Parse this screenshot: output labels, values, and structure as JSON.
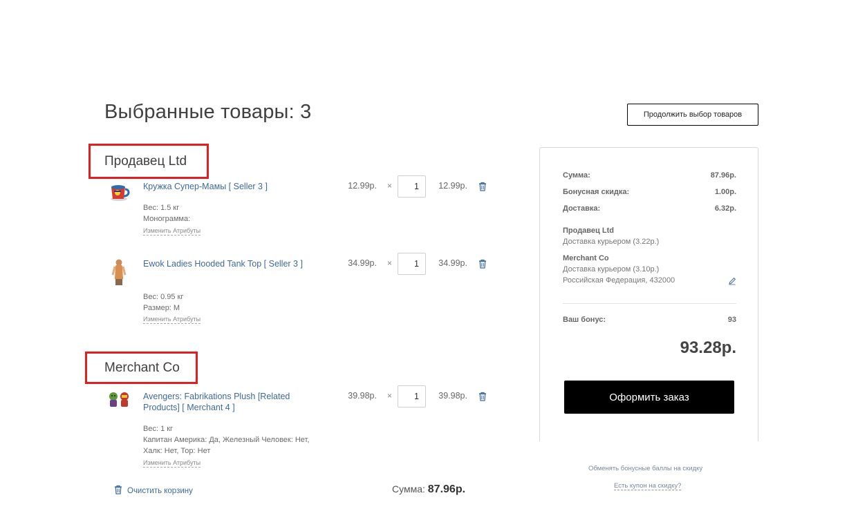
{
  "page": {
    "title": "Выбранные товары: 3",
    "continue_label": "Продолжить выбор товаров"
  },
  "sellers": [
    {
      "name": "Продавец Ltd",
      "items": [
        {
          "name": "Кружка Супер-Мамы [ Seller 3 ]",
          "attrs": [
            "Вес: 1.5 кг",
            "Монограмма:"
          ],
          "change_attrs": "Изменить Атрибуты",
          "price": "12.99р.",
          "times": "×",
          "qty": "1",
          "total": "12.99р.",
          "icon": "trash-icon"
        },
        {
          "name": "Ewok Ladies Hooded Tank Top [ Seller 3 ]",
          "attrs": [
            "Вес: 0.95 кг",
            "Размер: M"
          ],
          "change_attrs": "Изменить Атрибуты",
          "price": "34.99р.",
          "times": "×",
          "qty": "1",
          "total": "34.99р.",
          "icon": "trash-icon"
        }
      ]
    },
    {
      "name": "Merchant Co",
      "items": [
        {
          "name": "Avengers: Fabrikations Plush [Related Products] [ Merchant 4 ]",
          "attrs": [
            "Вес: 1 кг",
            "Капитан Америка: Да, Железный Человек: Нет, Халк: Нет, Тор: Нет"
          ],
          "change_attrs": "Изменить Атрибуты",
          "price": "39.98р.",
          "times": "×",
          "qty": "1",
          "total": "39.98р.",
          "icon": "trash-icon"
        }
      ]
    }
  ],
  "cart": {
    "clear_label": "Очистить корзину",
    "total_label": "Сумма:",
    "total_value": "87.96р."
  },
  "summary": {
    "rows": [
      {
        "label": "Сумма:",
        "value": "87.96р."
      },
      {
        "label": "Бонусная скидка:",
        "value": "1.00р."
      },
      {
        "label": "Доставка:",
        "value": "6.32р."
      }
    ],
    "shipping": [
      {
        "seller": "Продавец Ltd",
        "lines": [
          "Доставка курьером (3.22р.)"
        ]
      },
      {
        "seller": "Merchant Co",
        "lines": [
          "Доставка курьером (3.10р.)",
          "Российская Федерация, 432000"
        ]
      }
    ],
    "bonus_label": "Ваш бонус:",
    "bonus_value": "93",
    "grand_total": "93.28р.",
    "checkout_label": "Оформить заказ",
    "exchange_link": "Обменять бонусные баллы на скидку",
    "coupon_link": "Есть купон на скидку?"
  },
  "colors": {
    "highlight": "#e02020",
    "link": "#3d6aa1",
    "button": "#000000"
  }
}
